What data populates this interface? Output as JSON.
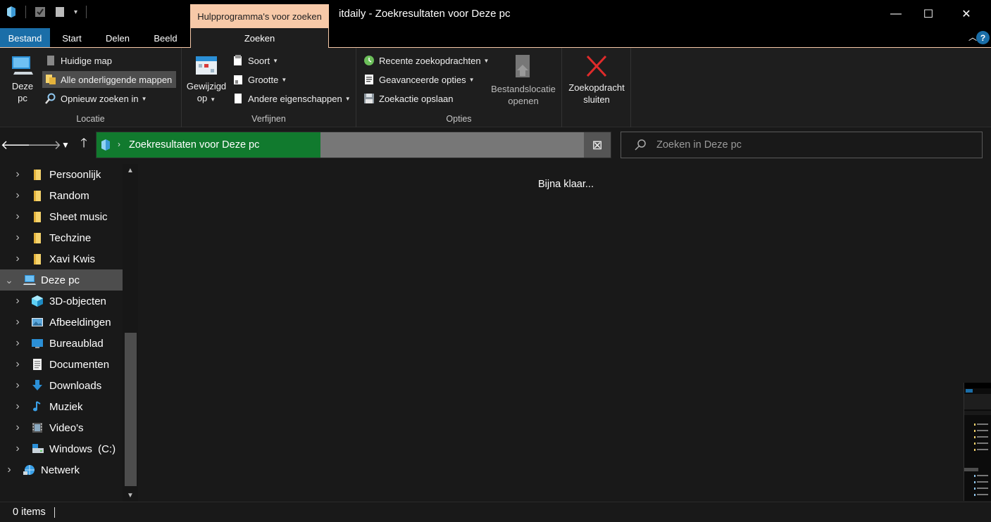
{
  "window": {
    "title": "itdaily - Zoekresultaten voor Deze pc",
    "context_tab_title": "Hulpprogramma's voor zoeken",
    "controls": {
      "minimize": "—",
      "maximize": "☐",
      "close": "✕"
    }
  },
  "ribbon_tabs": {
    "bestand": "Bestand",
    "start": "Start",
    "delen": "Delen",
    "beeld": "Beeld",
    "zoeken": "Zoeken"
  },
  "ribbon": {
    "locatie": {
      "label": "Locatie",
      "deze_pc_line1": "Deze",
      "deze_pc_line2": "pc",
      "huidige_map": "Huidige map",
      "alle_mappen": "Alle onderliggende mappen",
      "opnieuw_zoeken": "Opnieuw zoeken in"
    },
    "verfijnen": {
      "label": "Verfijnen",
      "gewijzigd_line1": "Gewijzigd",
      "gewijzigd_line2": "op",
      "soort": "Soort",
      "grootte": "Grootte",
      "andere": "Andere eigenschappen"
    },
    "opties": {
      "label": "Opties",
      "recente": "Recente zoekopdrachten",
      "geavanceerde": "Geavanceerde opties",
      "opslaan": "Zoekactie opslaan",
      "bestandslocatie_line1": "Bestandslocatie",
      "bestandslocatie_line2": "openen"
    },
    "sluiten": {
      "line1": "Zoekopdracht",
      "line2": "sluiten"
    }
  },
  "address_bar": {
    "path": "Zoekresultaten voor Deze pc",
    "progress_fraction": 0.46
  },
  "search": {
    "placeholder": "Zoeken in Deze pc"
  },
  "nav_tree": [
    {
      "label": "Persoonlijk",
      "icon": "folder-icon",
      "level": 1
    },
    {
      "label": "Random",
      "icon": "folder-icon",
      "level": 1
    },
    {
      "label": "Sheet music",
      "icon": "folder-icon",
      "level": 1
    },
    {
      "label": "Techzine",
      "icon": "folder-icon",
      "level": 1
    },
    {
      "label": "Xavi Kwis",
      "icon": "folder-icon",
      "level": 1
    },
    {
      "label": "Deze pc",
      "icon": "computer-icon",
      "level": 0,
      "expanded": true,
      "selected": true
    },
    {
      "label": "3D-objecten",
      "icon": "cube-icon",
      "level": 1
    },
    {
      "label": "Afbeeldingen",
      "icon": "pictures-icon",
      "level": 1
    },
    {
      "label": "Bureaublad",
      "icon": "desktop-icon",
      "level": 1
    },
    {
      "label": "Documenten",
      "icon": "document-icon",
      "level": 1
    },
    {
      "label": "Downloads",
      "icon": "download-icon",
      "level": 1
    },
    {
      "label": "Muziek",
      "icon": "music-icon",
      "level": 1
    },
    {
      "label": "Video's",
      "icon": "video-icon",
      "level": 1
    },
    {
      "label": "Windows  (C:)",
      "icon": "drive-icon",
      "level": 1
    },
    {
      "label": "Netwerk",
      "icon": "network-icon",
      "level": 0
    }
  ],
  "main": {
    "loading_text": "Bijna klaar..."
  },
  "status": {
    "item_count": "0 items"
  },
  "colors": {
    "accent_blue": "#1a6ea8",
    "context_tab": "#f7c9a8",
    "progress_green": "#117a2e"
  }
}
